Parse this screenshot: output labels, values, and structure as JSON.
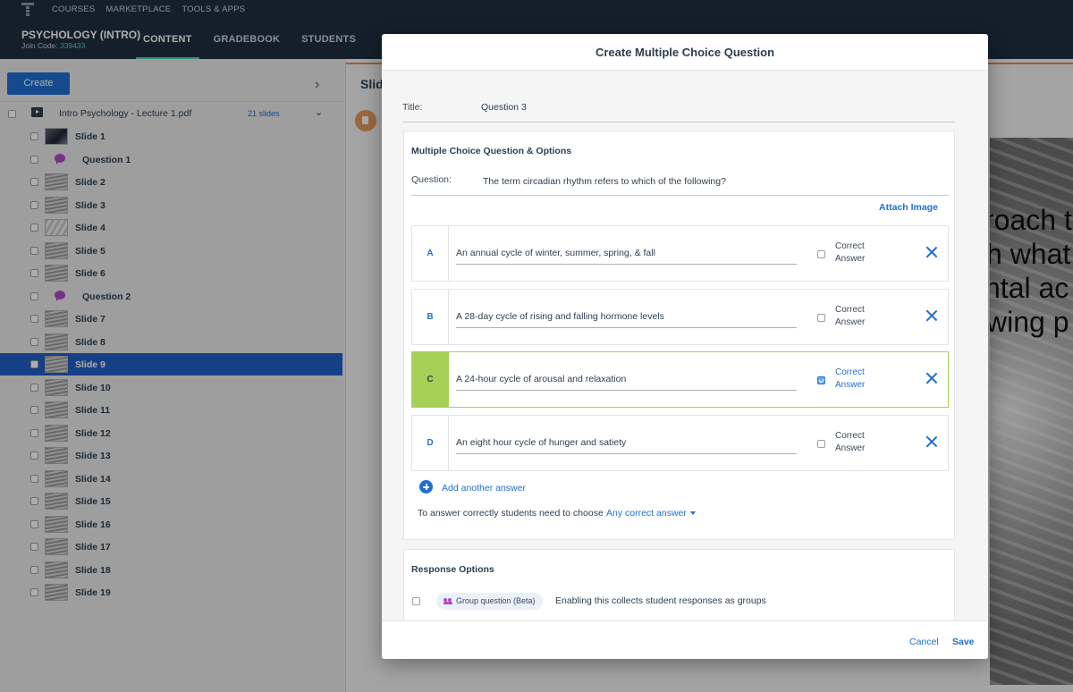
{
  "nav": {
    "links": [
      "COURSES",
      "MARKETPLACE",
      "TOOLS & APPS"
    ],
    "course_title": "PSYCHOLOGY (INTRO)",
    "join_label": "Join Code:",
    "join_code": "339433",
    "tabs": [
      "CONTENT",
      "GRADEBOOK",
      "STUDENTS"
    ],
    "active_tab": "CONTENT"
  },
  "sidebar": {
    "create_label": "Create",
    "file": {
      "name": "Intro Psychology - Lecture 1.pdf",
      "count": "21 slides"
    },
    "items": [
      {
        "label": "Slide 1",
        "type": "slide"
      },
      {
        "label": "Question 1",
        "type": "question"
      },
      {
        "label": "Slide 2",
        "type": "slide"
      },
      {
        "label": "Slide 3",
        "type": "slide"
      },
      {
        "label": "Slide 4",
        "type": "slide"
      },
      {
        "label": "Slide 5",
        "type": "slide"
      },
      {
        "label": "Slide 6",
        "type": "slide"
      },
      {
        "label": "Question 2",
        "type": "question"
      },
      {
        "label": "Slide 7",
        "type": "slide"
      },
      {
        "label": "Slide 8",
        "type": "slide"
      },
      {
        "label": "Slide 9",
        "type": "slide",
        "active": true
      },
      {
        "label": "Slide 10",
        "type": "slide"
      },
      {
        "label": "Slide 11",
        "type": "slide"
      },
      {
        "label": "Slide 12",
        "type": "slide"
      },
      {
        "label": "Slide 13",
        "type": "slide"
      },
      {
        "label": "Slide 14",
        "type": "slide"
      },
      {
        "label": "Slide 15",
        "type": "slide"
      },
      {
        "label": "Slide 16",
        "type": "slide"
      },
      {
        "label": "Slide 17",
        "type": "slide"
      },
      {
        "label": "Slide 18",
        "type": "slide"
      },
      {
        "label": "Slide 19",
        "type": "slide"
      }
    ]
  },
  "main": {
    "heading": "Slid",
    "slide_text": [
      "roach t",
      "h what",
      "ntal ac",
      "wing p"
    ]
  },
  "modal": {
    "title": "Create Multiple Choice Question",
    "title_label": "Title:",
    "title_value": "Question 3",
    "section_heading": "Multiple Choice Question & Options",
    "question_label": "Question:",
    "question_value": "The term circadian rhythm refers to which of the following?",
    "attach_label": "Attach Image",
    "correct_label": "Correct Answer",
    "answers": [
      {
        "letter": "A",
        "text": "An annual cycle of winter, summer, spring, & fall",
        "correct": false
      },
      {
        "letter": "B",
        "text": "A 28-day cycle of rising and falling hormone levels",
        "correct": false
      },
      {
        "letter": "C",
        "text": "A 24-hour cycle of arousal and relaxation",
        "correct": true
      },
      {
        "letter": "D",
        "text": "An eight hour cycle of hunger and satiety",
        "correct": false
      }
    ],
    "add_answer_label": "Add another answer",
    "rule_text": "To answer correctly students need to choose",
    "rule_value": "Any correct answer",
    "response_heading": "Response Options",
    "group_pill": "Group question (Beta)",
    "group_desc": "Enabling this collects student responses as groups",
    "cancel_label": "Cancel",
    "save_label": "Save"
  },
  "colors": {
    "accent": "#1f6fd1",
    "correct": "#a6d158",
    "topbar": "#1e2f40",
    "teal": "#4dd0b0"
  }
}
